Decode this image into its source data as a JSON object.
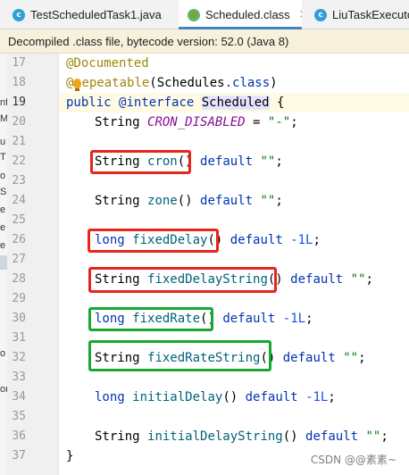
{
  "tabs": [
    {
      "label": "TestScheduledTask1.java",
      "icon": "class-icon",
      "icon_letter": "c",
      "active": false
    },
    {
      "label": "Scheduled.class",
      "icon": "annotation-icon",
      "icon_letter": "@",
      "active": true
    },
    {
      "label": "LiuTaskExecuto",
      "icon": "class-icon",
      "icon_letter": "c",
      "active": false
    }
  ],
  "close_glyph": "×",
  "banner": {
    "text": "Decompiled .class file, bytecode version: 52.0 (Java 8)"
  },
  "left_panel_fragments": [
    "nf",
    "M",
    "u",
    "T",
    "o",
    "S",
    "e",
    "e",
    "e",
    "o",
    "or"
  ],
  "line_numbers": [
    "17",
    "18",
    "19",
    "20",
    "21",
    "22",
    "23",
    "24",
    "25",
    "26",
    "27",
    "28",
    "29",
    "30",
    "31",
    "32",
    "33",
    "34",
    "35",
    "36",
    "37"
  ],
  "code": {
    "l17_annotation": "@Documented",
    "l18_annotation_a": "@",
    "l18_annotation_b": "epeatable",
    "l18_paren_open": "(",
    "l18_class": "Schedules",
    "l18_dot_class": ".class",
    "l18_paren_close": ")",
    "l19_public": "public",
    "l19_interface": "@interface",
    "l19_name": "Scheduled",
    "l19_brace": "{",
    "l20_type": "String",
    "l20_const": "CRON_DISABLED",
    "l20_eq": "=",
    "l20_val": "\"-\"",
    "l20_semi": ";",
    "l22_type": "String",
    "l22_method": "cron",
    "l22_parens": "()",
    "l22_default": "default",
    "l22_val": "\"\"",
    "l22_semi": ";",
    "l24_type": "String",
    "l24_method": "zone",
    "l24_parens": "()",
    "l24_default": "default",
    "l24_val": "\"\"",
    "l24_semi": ";",
    "l26_type": "long",
    "l26_method": "fixedDelay",
    "l26_parens": "()",
    "l26_default": "default",
    "l26_val": "-1L",
    "l26_semi": ";",
    "l28_type": "String",
    "l28_method": "fixedDelayString",
    "l28_parens": "()",
    "l28_default": "default",
    "l28_val": "\"\"",
    "l28_semi": ";",
    "l30_type": "long",
    "l30_method": "fixedRate",
    "l30_parens": "()",
    "l30_default": "default",
    "l30_val": "-1L",
    "l30_semi": ";",
    "l32_type": "String",
    "l32_method": "fixedRateString",
    "l32_parens": "()",
    "l32_default": "default",
    "l32_val": "\"\"",
    "l32_semi": ";",
    "l34_type": "long",
    "l34_method": "initialDelay",
    "l34_parens": "()",
    "l34_default": "default",
    "l34_val": "-1L",
    "l34_semi": ";",
    "l36_type": "String",
    "l36_method": "initialDelayString",
    "l36_parens": "()",
    "l36_default": "default",
    "l36_val": "\"\"",
    "l36_semi": ";",
    "l37_brace": "}"
  },
  "watermark": "CSDN @@素素~",
  "colors": {
    "keyword": "#0033b3",
    "annotation": "#9e880d",
    "string": "#067d17",
    "constant": "#871094",
    "highlight_red": "#e8241b",
    "highlight_green": "#18a832",
    "active_tab_underline": "#4083c9"
  }
}
